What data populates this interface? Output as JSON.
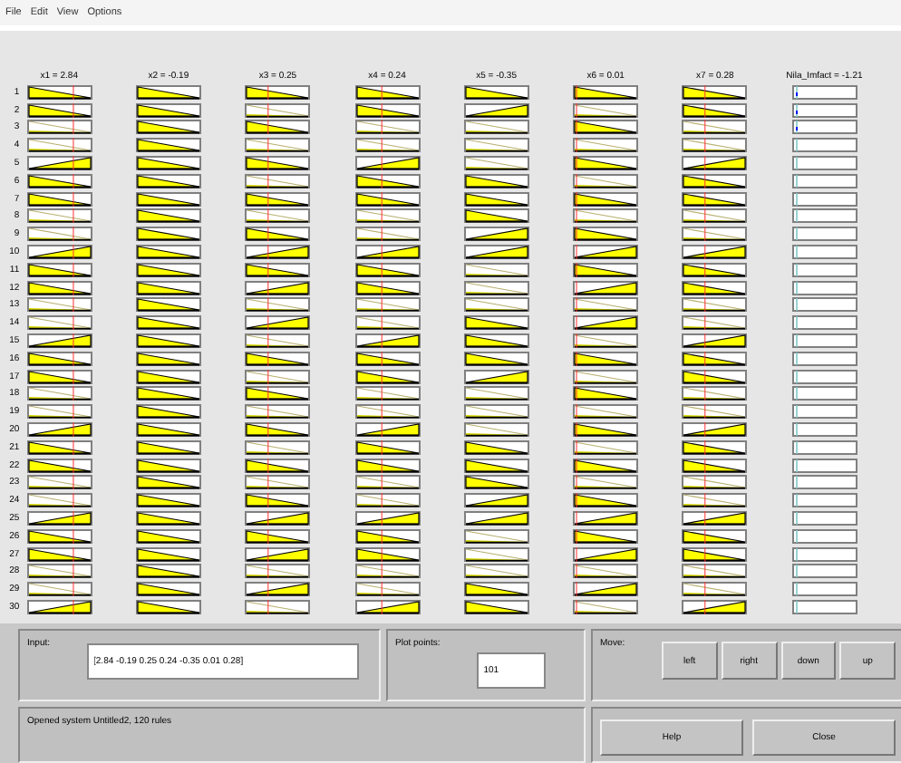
{
  "menu": [
    "File",
    "Edit",
    "View",
    "Options"
  ],
  "columns": [
    {
      "kind": "input",
      "label": "x1 = 2.84"
    },
    {
      "kind": "input",
      "label": "x2 = -0.19"
    },
    {
      "kind": "input",
      "label": "x3 = 0.25"
    },
    {
      "kind": "input",
      "label": "x4 = 0.24"
    },
    {
      "kind": "input",
      "label": "x5 = -0.35"
    },
    {
      "kind": "input",
      "label": "x6 = 0.01"
    },
    {
      "kind": "input",
      "label": "x7 = 0.28"
    },
    {
      "kind": "output",
      "label": "Nila_Imfact = -1.21"
    }
  ],
  "rows": [
    "1",
    "2",
    "3",
    "4",
    "5",
    "6",
    "7",
    "8",
    "9",
    "10",
    "11",
    "12",
    "13",
    "14",
    "15",
    "16",
    "17",
    "18",
    "19",
    "20",
    "21",
    "22",
    "23",
    "24",
    "25",
    "26",
    "27",
    "28",
    "29",
    "30"
  ],
  "input": {
    "label": "Input:",
    "value": "[2.84 -0.19 0.25 0.24 -0.35 0.01 0.28]"
  },
  "plot_points": {
    "label": "Plot points:",
    "value": "101"
  },
  "move": {
    "label": "Move:",
    "buttons": [
      "left",
      "right",
      "down",
      "up"
    ]
  },
  "status": "Opened system Untitled2, 120 rules",
  "buttons": [
    "Help",
    "Close"
  ]
}
